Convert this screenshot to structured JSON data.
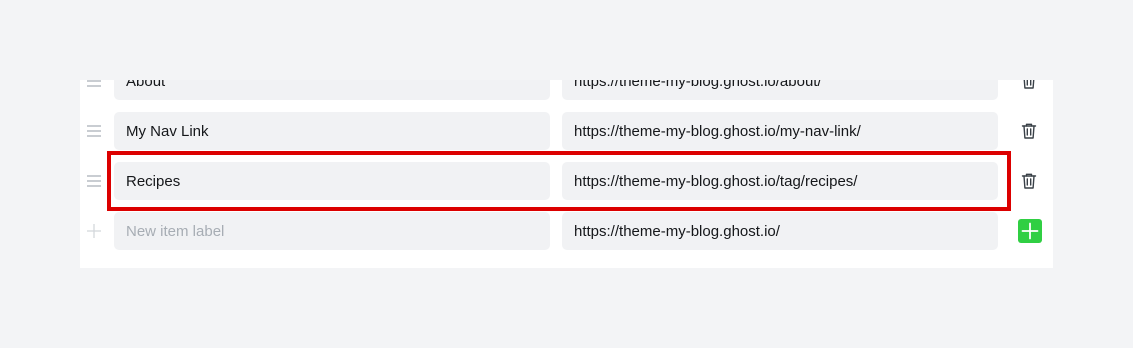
{
  "nav_items": [
    {
      "label": "About",
      "url": "https://theme-my-blog.ghost.io/about/"
    },
    {
      "label": "My Nav Link",
      "url": "https://theme-my-blog.ghost.io/my-nav-link/"
    },
    {
      "label": "Recipes",
      "url": "https://theme-my-blog.ghost.io/tag/recipes/"
    }
  ],
  "new_item": {
    "label_placeholder": "New item label",
    "url_value": "https://theme-my-blog.ghost.io/"
  },
  "icons": {
    "drag": "drag-handle-icon",
    "delete": "trash-icon",
    "add": "plus-icon"
  },
  "colors": {
    "add_button": "#30cf43",
    "highlight": "#dc0000",
    "field_bg": "#f1f2f4"
  }
}
